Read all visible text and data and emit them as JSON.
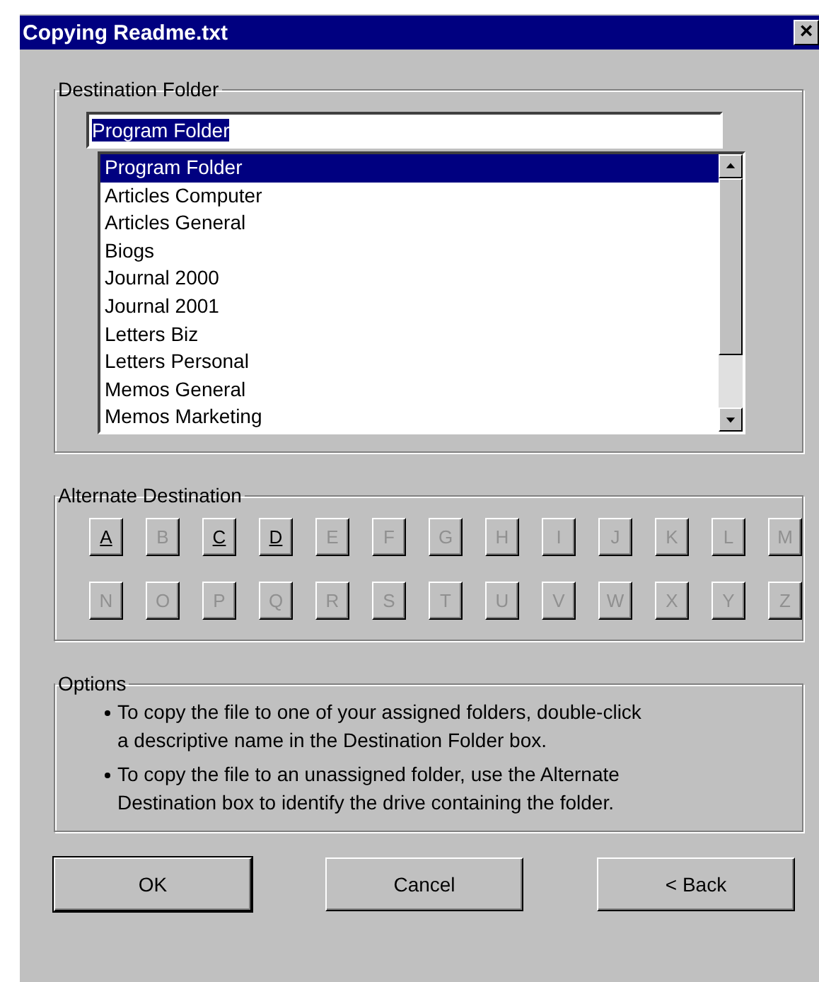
{
  "window": {
    "title": "Copying Readme.txt",
    "close": "×"
  },
  "destination": {
    "legend": "Destination Folder",
    "value": "Program Folder",
    "items": [
      {
        "label": "Program Folder",
        "selected": true
      },
      {
        "label": "Articles Computer",
        "selected": false
      },
      {
        "label": "Articles General",
        "selected": false
      },
      {
        "label": "Biogs",
        "selected": false
      },
      {
        "label": "Journal 2000",
        "selected": false
      },
      {
        "label": "Journal 2001",
        "selected": false
      },
      {
        "label": "Letters Biz",
        "selected": false
      },
      {
        "label": "Letters Personal",
        "selected": false
      },
      {
        "label": "Memos General",
        "selected": false
      },
      {
        "label": "Memos Marketing",
        "selected": false
      }
    ]
  },
  "alternate": {
    "legend": "Alternate Destination",
    "drives": [
      {
        "label": "A",
        "disabled": false
      },
      {
        "label": "B",
        "disabled": true
      },
      {
        "label": "C",
        "disabled": false
      },
      {
        "label": "D",
        "disabled": false
      },
      {
        "label": "E",
        "disabled": true
      },
      {
        "label": "F",
        "disabled": true
      },
      {
        "label": "G",
        "disabled": true
      },
      {
        "label": "H",
        "disabled": true
      },
      {
        "label": "I",
        "disabled": true
      },
      {
        "label": "J",
        "disabled": true
      },
      {
        "label": "K",
        "disabled": true
      },
      {
        "label": "L",
        "disabled": true
      },
      {
        "label": "M",
        "disabled": true
      },
      {
        "label": "N",
        "disabled": true
      },
      {
        "label": "O",
        "disabled": true
      },
      {
        "label": "P",
        "disabled": true
      },
      {
        "label": "Q",
        "disabled": true
      },
      {
        "label": "R",
        "disabled": true
      },
      {
        "label": "S",
        "disabled": true
      },
      {
        "label": "T",
        "disabled": true
      },
      {
        "label": "U",
        "disabled": true
      },
      {
        "label": "V",
        "disabled": true
      },
      {
        "label": "W",
        "disabled": true
      },
      {
        "label": "X",
        "disabled": true
      },
      {
        "label": "Y",
        "disabled": true
      },
      {
        "label": "Z",
        "disabled": true
      }
    ]
  },
  "options": {
    "legend": "Options",
    "bullets": [
      "To copy the file to one of your assigned folders, double-click a descriptive name in the Destination Folder box.",
      "To copy the file to an unassigned folder, use the Alternate Destination box to identify the drive containing the folder."
    ]
  },
  "buttons": [
    {
      "label": "OK",
      "default": true
    },
    {
      "label": "Cancel",
      "default": false
    },
    {
      "label": "< Back",
      "default": false
    }
  ]
}
